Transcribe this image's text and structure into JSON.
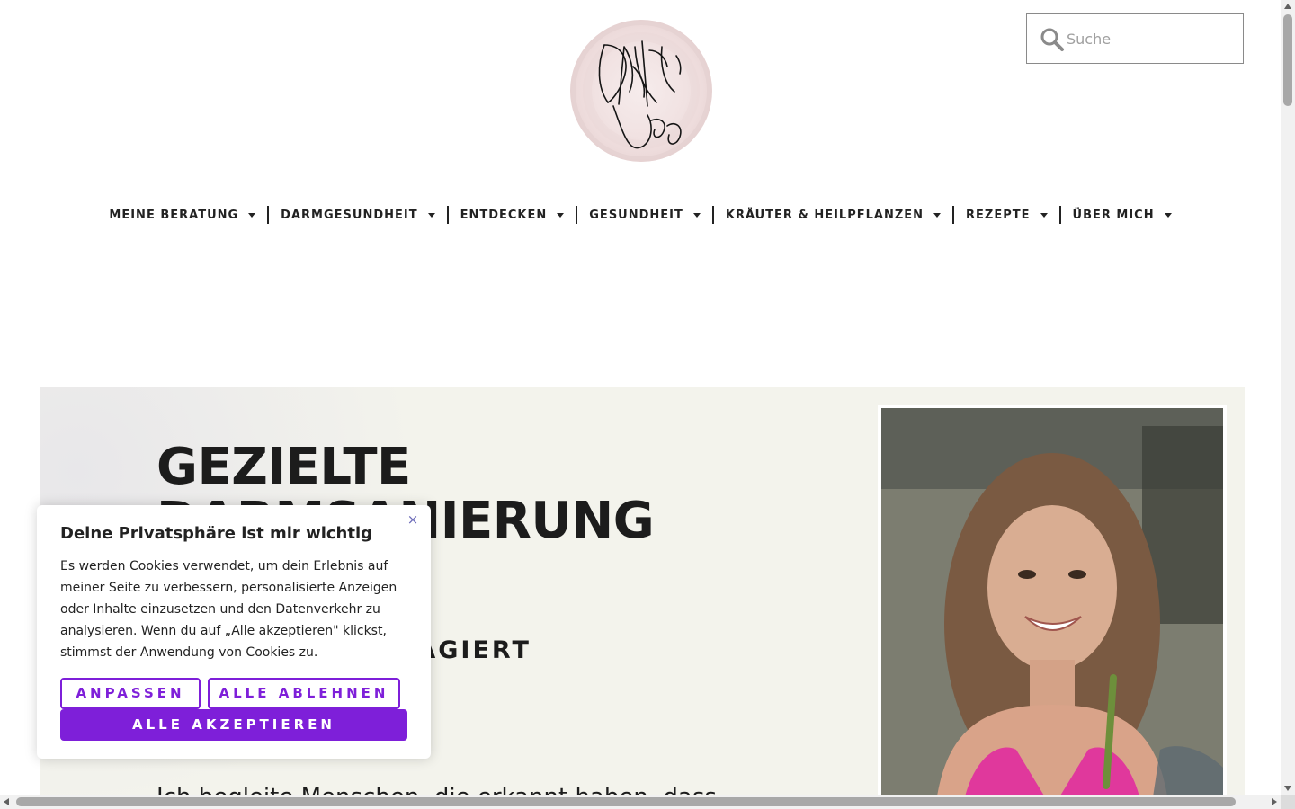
{
  "header": {
    "logo_text": "DANI's WEG",
    "search": {
      "placeholder": "Suche",
      "value": ""
    }
  },
  "nav": {
    "items": [
      {
        "label": "MEINE BERATUNG"
      },
      {
        "label": "DARMGESUNDHEIT"
      },
      {
        "label": "ENTDECKEN"
      },
      {
        "label": "GESUNDHEIT"
      },
      {
        "label": "KRÄUTER & HEILPFLANZEN"
      },
      {
        "label": "REZEPTE"
      },
      {
        "label": "ÜBER MICH"
      }
    ]
  },
  "hero": {
    "title_line1": "GEZIELTE",
    "title_line2": "DARMSANIERUNG",
    "subtitle": "FUNDIERT – ENGAGIERT",
    "text": "Ich begleite Menschen, die erkannt haben, dass"
  },
  "cookie_banner": {
    "title": "Deine Privatsphäre ist mir wichtig",
    "text": "Es werden Cookies verwendet, um dein Erlebnis auf meiner Seite zu verbessern, personalisierte Anzeigen oder Inhalte einzusetzen und den Datenverkehr zu analysieren. Wenn du auf „Alle akzeptieren\" klickst, stimmst der Anwendung von Cookies zu.",
    "close_symbol": "×",
    "customize_label": "ANPASSEN",
    "reject_label": "ALLE ABLEHNEN",
    "accept_label": "ALLE AKZEPTIEREN"
  },
  "colors": {
    "accent": "#7e1fd9",
    "text": "#1c1c1c",
    "hero_bg": "#f3f3ec"
  }
}
